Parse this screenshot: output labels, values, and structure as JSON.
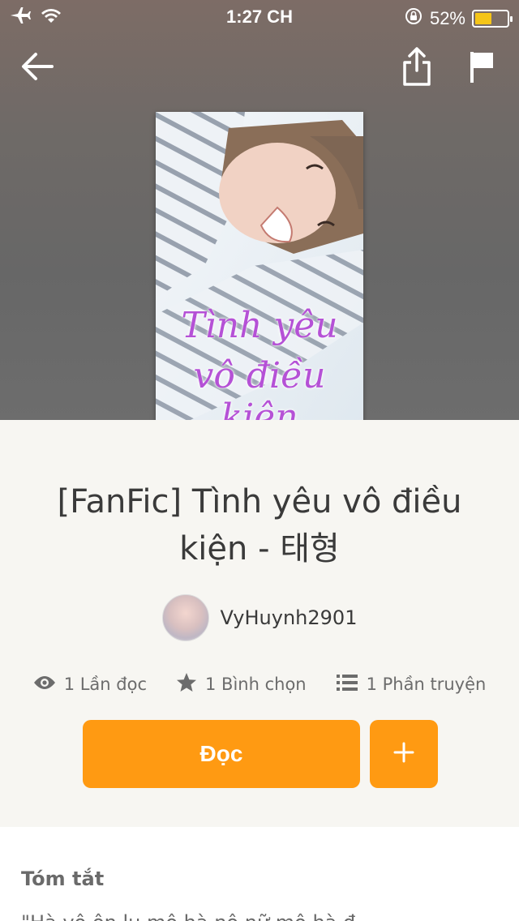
{
  "status_bar": {
    "time": "1:27 CH",
    "battery_percent": "52%",
    "battery_level": 0.52
  },
  "header": {
    "back_icon": "arrow-left-icon",
    "share_icon": "share-icon",
    "report_icon": "flag-icon"
  },
  "cover": {
    "title_line1": "Tình yêu",
    "title_line2": "vô điều kiện"
  },
  "story": {
    "title": "[FanFic] Tình yêu vô điều kiện - 태형",
    "author": "VyHuynh2901"
  },
  "stats": {
    "reads": "1 Lần đọc",
    "votes": "1 Bình chọn",
    "parts": "1 Phần truyện"
  },
  "actions": {
    "read_label": "Đọc",
    "add_label": "+"
  },
  "summary": {
    "heading": "Tóm tắt",
    "text": "\"Hà vô ôn lu mô hà nô nữ mô hà đ..."
  },
  "colors": {
    "accent": "#ff9a12",
    "cover_title": "#b551d6",
    "battery": "#f5c518"
  }
}
